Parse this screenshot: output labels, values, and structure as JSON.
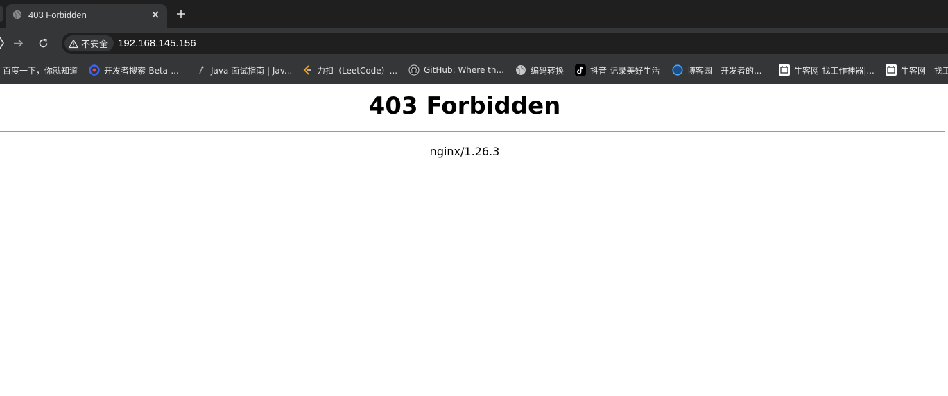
{
  "browser": {
    "tab": {
      "title": "403 Forbidden",
      "favicon": "globe-icon"
    },
    "new_tab_icon": "plus-icon",
    "toolbar": {
      "security_label": "不安全",
      "url": "192.168.145.156"
    },
    "bookmarks": [
      {
        "label": "百度一下，你就知道",
        "icon": "none"
      },
      {
        "label": "开发者搜索-Beta-...",
        "icon": "devsearch-icon"
      },
      {
        "label": "Java 面试指南 | Jav...",
        "icon": "java-icon"
      },
      {
        "label": "力扣（LeetCode）...",
        "icon": "leetcode-icon"
      },
      {
        "label": "GitHub: Where th...",
        "icon": "github-icon"
      },
      {
        "label": "编码转换",
        "icon": "globe-icon"
      },
      {
        "label": "抖音-记录美好生活",
        "icon": "douyin-icon"
      },
      {
        "label": "博客园 - 开发者的...",
        "icon": "cnblogs-icon"
      },
      {
        "label": "牛客网-找工作神器|...",
        "icon": "nowcoder-icon"
      },
      {
        "label": "牛客网 - 找工",
        "icon": "nowcoder-icon"
      }
    ]
  },
  "page": {
    "heading": "403 Forbidden",
    "server_info": "nginx/1.26.3"
  },
  "colors": {
    "tabstrip_bg": "#1f1f1f",
    "toolbar_bg": "#353638",
    "page_bg": "#ffffff"
  }
}
